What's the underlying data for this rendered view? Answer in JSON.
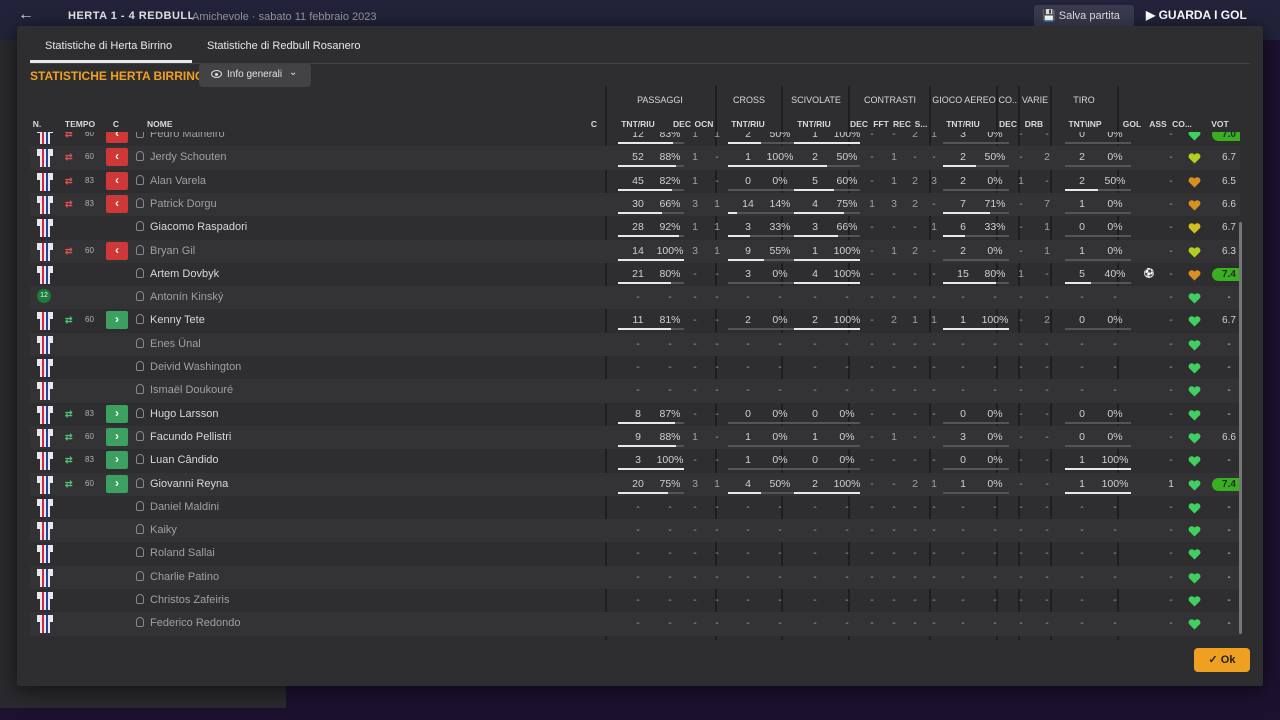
{
  "background": {
    "score": "HERTA  1 - 4  REDBULL",
    "venue": "Amichevole  ·  sabato 11 febbraio 2023",
    "save_label": "Salva partita",
    "watch_label": "GUARDA I GOL"
  },
  "tabs": [
    "Statistiche di Herta Birrino",
    "Statistiche di Redbull Rosanero"
  ],
  "title": "STATISTICHE HERTA BIRRINO",
  "view_select": "Info generali",
  "group_headers": [
    "PASSAGGI",
    "CROSS",
    "SCIVOLATE",
    "CONTRASTI",
    "GIOCO AEREO",
    "CO...",
    "VARIE",
    "TIRO"
  ],
  "sub_headers": {
    "n": "N.",
    "tempo": "TEMPO",
    "c": "C",
    "nome": "NOME",
    "c2": "C",
    "pass": "TNT/RIU",
    "dec": "DEC",
    "ocn": "OCN",
    "cross": "TNT/RIU",
    "scivolate": "TNT/RIU",
    "c_dec": "DEC",
    "c_fft": "FFT",
    "c_rec": "REC",
    "c_s": "S...",
    "aereo": "TNT/RIU",
    "co_dec": "DEC",
    "drb": "DRB",
    "tiro": "TNT\\INP",
    "gol": "GOL",
    "ass": "ASS",
    "co": "CO...",
    "vot": "VOT"
  },
  "colors": {
    "accent": "#f0a020",
    "sub_out": "#d03838",
    "sub_in": "#3ca060",
    "rating_good": "#38b020"
  },
  "rows": [
    {
      "kit": "shirt",
      "sub": "out",
      "min": "60",
      "name": "Pedro Malheiro",
      "starter": false,
      "pass": [
        "12",
        "83%"
      ],
      "dec": "1",
      "ocn": "1",
      "cross": [
        "2",
        "50%"
      ],
      "sciv": [
        "1",
        "100%"
      ],
      "c": [
        "-",
        "-",
        "2",
        "1"
      ],
      "aer": [
        "3",
        "0%"
      ],
      "codec": "-",
      "drb": "-",
      "tiro": [
        "0",
        "0%"
      ],
      "gol": "",
      "ass": "-",
      "heart": "green",
      "vot": "7.0",
      "votgreen": true
    },
    {
      "kit": "shirt",
      "sub": "out",
      "min": "60",
      "name": "Jerdy Schouten",
      "starter": false,
      "pass": [
        "52",
        "88%"
      ],
      "dec": "1",
      "ocn": "-",
      "cross": [
        "1",
        "100%"
      ],
      "sciv": [
        "2",
        "50%"
      ],
      "c": [
        "-",
        "1",
        "-",
        "-"
      ],
      "aer": [
        "2",
        "50%"
      ],
      "codec": "-",
      "drb": "2",
      "tiro": [
        "2",
        "0%"
      ],
      "gol": "",
      "ass": "-",
      "heart": "yellowgreen",
      "vot": "6.7",
      "votgreen": false
    },
    {
      "kit": "shirt",
      "sub": "out",
      "min": "83",
      "name": "Alan Varela",
      "starter": false,
      "pass": [
        "45",
        "82%"
      ],
      "dec": "1",
      "ocn": "-",
      "cross": [
        "0",
        "0%"
      ],
      "sciv": [
        "5",
        "60%"
      ],
      "c": [
        "-",
        "1",
        "2",
        "3"
      ],
      "aer": [
        "2",
        "0%"
      ],
      "codec": "1",
      "drb": "-",
      "tiro": [
        "2",
        "50%"
      ],
      "gol": "",
      "ass": "-",
      "heart": "orange",
      "vot": "6.5",
      "votgreen": false
    },
    {
      "kit": "shirt",
      "sub": "out",
      "min": "83",
      "name": "Patrick Dorgu",
      "starter": false,
      "pass": [
        "30",
        "66%"
      ],
      "dec": "3",
      "ocn": "1",
      "cross": [
        "14",
        "14%"
      ],
      "sciv": [
        "4",
        "75%"
      ],
      "c": [
        "1",
        "3",
        "2",
        "-"
      ],
      "aer": [
        "7",
        "71%"
      ],
      "codec": "-",
      "drb": "7",
      "tiro": [
        "1",
        "0%"
      ],
      "gol": "",
      "ass": "-",
      "heart": "orange",
      "vot": "6.6",
      "votgreen": false
    },
    {
      "kit": "shirt",
      "sub": "",
      "min": "",
      "name": "Giacomo Raspadori",
      "starter": true,
      "pass": [
        "28",
        "92%"
      ],
      "dec": "1",
      "ocn": "1",
      "cross": [
        "3",
        "33%"
      ],
      "sciv": [
        "3",
        "66%"
      ],
      "c": [
        "-",
        "-",
        "-",
        "1"
      ],
      "aer": [
        "6",
        "33%"
      ],
      "codec": "-",
      "drb": "1",
      "tiro": [
        "0",
        "0%"
      ],
      "gol": "",
      "ass": "-",
      "heart": "yellow",
      "vot": "6.7",
      "votgreen": false
    },
    {
      "kit": "shirt",
      "sub": "out",
      "min": "60",
      "name": "Bryan Gil",
      "starter": false,
      "pass": [
        "14",
        "100%"
      ],
      "dec": "3",
      "ocn": "1",
      "cross": [
        "9",
        "55%"
      ],
      "sciv": [
        "1",
        "100%"
      ],
      "c": [
        "-",
        "1",
        "2",
        "-"
      ],
      "aer": [
        "2",
        "0%"
      ],
      "codec": "-",
      "drb": "1",
      "tiro": [
        "1",
        "0%"
      ],
      "gol": "",
      "ass": "-",
      "heart": "yellowgreen",
      "vot": "6.3",
      "votgreen": false
    },
    {
      "kit": "shirt",
      "sub": "",
      "min": "",
      "name": "Artem Dovbyk",
      "starter": true,
      "pass": [
        "21",
        "80%"
      ],
      "dec": "-",
      "ocn": "-",
      "cross": [
        "3",
        "0%"
      ],
      "sciv": [
        "4",
        "100%"
      ],
      "c": [
        "-",
        "-",
        "-",
        "-"
      ],
      "aer": [
        "15",
        "80%"
      ],
      "codec": "1",
      "drb": "-",
      "tiro": [
        "5",
        "40%"
      ],
      "gol": "ball",
      "ass": "-",
      "heart": "orange",
      "vot": "7.4",
      "votgreen": true
    },
    {
      "kit": "gk",
      "gknum": "12",
      "sub": "",
      "min": "",
      "name": "Antonín Kinský",
      "starter": false,
      "pass": [
        "-",
        "-"
      ],
      "dec": "-",
      "ocn": "-",
      "cross": [
        "-",
        "-"
      ],
      "sciv": [
        "-",
        "-"
      ],
      "c": [
        "-",
        "-",
        "-",
        "-"
      ],
      "aer": [
        "-",
        "-"
      ],
      "codec": "-",
      "drb": "-",
      "tiro": [
        "-",
        "-"
      ],
      "gol": "",
      "ass": "-",
      "heart": "green",
      "vot": "-",
      "votgreen": false
    },
    {
      "kit": "shirt",
      "sub": "in",
      "min": "60",
      "name": "Kenny Tete",
      "starter": true,
      "pass": [
        "11",
        "81%"
      ],
      "dec": "-",
      "ocn": "-",
      "cross": [
        "2",
        "0%"
      ],
      "sciv": [
        "2",
        "100%"
      ],
      "c": [
        "-",
        "2",
        "1",
        "1"
      ],
      "aer": [
        "1",
        "100%"
      ],
      "codec": "-",
      "drb": "2",
      "tiro": [
        "0",
        "0%"
      ],
      "gol": "",
      "ass": "-",
      "heart": "green",
      "vot": "6.7",
      "votgreen": false
    },
    {
      "kit": "shirt",
      "sub": "",
      "min": "",
      "name": "Enes Ünal",
      "starter": false,
      "pass": [
        "-",
        "-"
      ],
      "dec": "-",
      "ocn": "-",
      "cross": [
        "-",
        "-"
      ],
      "sciv": [
        "-",
        "-"
      ],
      "c": [
        "-",
        "-",
        "-",
        "-"
      ],
      "aer": [
        "-",
        "-"
      ],
      "codec": "-",
      "drb": "-",
      "tiro": [
        "-",
        "-"
      ],
      "gol": "",
      "ass": "-",
      "heart": "green",
      "vot": "-",
      "votgreen": false
    },
    {
      "kit": "shirt",
      "sub": "",
      "min": "",
      "name": "Deivid Washington",
      "starter": false,
      "pass": [
        "-",
        "-"
      ],
      "dec": "-",
      "ocn": "-",
      "cross": [
        "-",
        "-"
      ],
      "sciv": [
        "-",
        "-"
      ],
      "c": [
        "-",
        "-",
        "-",
        "-"
      ],
      "aer": [
        "-",
        "-"
      ],
      "codec": "-",
      "drb": "-",
      "tiro": [
        "-",
        "-"
      ],
      "gol": "",
      "ass": "-",
      "heart": "green",
      "vot": "-",
      "votgreen": false
    },
    {
      "kit": "shirt",
      "sub": "",
      "min": "",
      "name": "Ismaël Doukouré",
      "starter": false,
      "pass": [
        "-",
        "-"
      ],
      "dec": "-",
      "ocn": "-",
      "cross": [
        "-",
        "-"
      ],
      "sciv": [
        "-",
        "-"
      ],
      "c": [
        "-",
        "-",
        "-",
        "-"
      ],
      "aer": [
        "-",
        "-"
      ],
      "codec": "-",
      "drb": "-",
      "tiro": [
        "-",
        "-"
      ],
      "gol": "",
      "ass": "-",
      "heart": "green",
      "vot": "-",
      "votgreen": false
    },
    {
      "kit": "shirt",
      "sub": "in",
      "min": "83",
      "name": "Hugo Larsson",
      "starter": true,
      "pass": [
        "8",
        "87%"
      ],
      "dec": "-",
      "ocn": "-",
      "cross": [
        "0",
        "0%"
      ],
      "sciv": [
        "0",
        "0%"
      ],
      "c": [
        "-",
        "-",
        "-",
        "-"
      ],
      "aer": [
        "0",
        "0%"
      ],
      "codec": "-",
      "drb": "-",
      "tiro": [
        "0",
        "0%"
      ],
      "gol": "",
      "ass": "-",
      "heart": "green",
      "vot": "-",
      "votgreen": false
    },
    {
      "kit": "shirt",
      "sub": "in",
      "min": "60",
      "name": "Facundo Pellistri",
      "starter": true,
      "pass": [
        "9",
        "88%"
      ],
      "dec": "1",
      "ocn": "-",
      "cross": [
        "1",
        "0%"
      ],
      "sciv": [
        "1",
        "0%"
      ],
      "c": [
        "-",
        "1",
        "-",
        "-"
      ],
      "aer": [
        "3",
        "0%"
      ],
      "codec": "-",
      "drb": "-",
      "tiro": [
        "0",
        "0%"
      ],
      "gol": "",
      "ass": "-",
      "heart": "green",
      "vot": "6.6",
      "votgreen": false
    },
    {
      "kit": "shirt",
      "sub": "in",
      "min": "83",
      "name": "Luan Cândido",
      "starter": true,
      "pass": [
        "3",
        "100%"
      ],
      "dec": "-",
      "ocn": "-",
      "cross": [
        "1",
        "0%"
      ],
      "sciv": [
        "0",
        "0%"
      ],
      "c": [
        "-",
        "-",
        "-",
        "-"
      ],
      "aer": [
        "0",
        "0%"
      ],
      "codec": "-",
      "drb": "-",
      "tiro": [
        "1",
        "100%"
      ],
      "gol": "",
      "ass": "-",
      "heart": "green",
      "vot": "-",
      "votgreen": false
    },
    {
      "kit": "shirt",
      "sub": "in",
      "min": "60",
      "name": "Giovanni Reyna",
      "starter": true,
      "pass": [
        "20",
        "75%"
      ],
      "dec": "3",
      "ocn": "1",
      "cross": [
        "4",
        "50%"
      ],
      "sciv": [
        "2",
        "100%"
      ],
      "c": [
        "-",
        "-",
        "2",
        "1"
      ],
      "aer": [
        "1",
        "0%"
      ],
      "codec": "-",
      "drb": "-",
      "tiro": [
        "1",
        "100%"
      ],
      "gol": "",
      "ass": "1",
      "heart": "green",
      "vot": "7.4",
      "votgreen": true
    },
    {
      "kit": "shirt",
      "sub": "",
      "min": "",
      "name": "Daniel Maldini",
      "starter": false,
      "pass": [
        "-",
        "-"
      ],
      "dec": "-",
      "ocn": "-",
      "cross": [
        "-",
        "-"
      ],
      "sciv": [
        "-",
        "-"
      ],
      "c": [
        "-",
        "-",
        "-",
        "-"
      ],
      "aer": [
        "-",
        "-"
      ],
      "codec": "-",
      "drb": "-",
      "tiro": [
        "-",
        "-"
      ],
      "gol": "",
      "ass": "-",
      "heart": "green",
      "vot": "-",
      "votgreen": false
    },
    {
      "kit": "shirt",
      "sub": "",
      "min": "",
      "name": "Kaiky",
      "starter": false,
      "pass": [
        "-",
        "-"
      ],
      "dec": "-",
      "ocn": "-",
      "cross": [
        "-",
        "-"
      ],
      "sciv": [
        "-",
        "-"
      ],
      "c": [
        "-",
        "-",
        "-",
        "-"
      ],
      "aer": [
        "-",
        "-"
      ],
      "codec": "-",
      "drb": "-",
      "tiro": [
        "-",
        "-"
      ],
      "gol": "",
      "ass": "-",
      "heart": "green",
      "vot": "-",
      "votgreen": false
    },
    {
      "kit": "shirt",
      "sub": "",
      "min": "",
      "name": "Roland Sallai",
      "starter": false,
      "pass": [
        "-",
        "-"
      ],
      "dec": "-",
      "ocn": "-",
      "cross": [
        "-",
        "-"
      ],
      "sciv": [
        "-",
        "-"
      ],
      "c": [
        "-",
        "-",
        "-",
        "-"
      ],
      "aer": [
        "-",
        "-"
      ],
      "codec": "-",
      "drb": "-",
      "tiro": [
        "-",
        "-"
      ],
      "gol": "",
      "ass": "-",
      "heart": "green",
      "vot": "-",
      "votgreen": false
    },
    {
      "kit": "shirt",
      "sub": "",
      "min": "",
      "name": "Charlie Patino",
      "starter": false,
      "pass": [
        "-",
        "-"
      ],
      "dec": "-",
      "ocn": "-",
      "cross": [
        "-",
        "-"
      ],
      "sciv": [
        "-",
        "-"
      ],
      "c": [
        "-",
        "-",
        "-",
        "-"
      ],
      "aer": [
        "-",
        "-"
      ],
      "codec": "-",
      "drb": "-",
      "tiro": [
        "-",
        "-"
      ],
      "gol": "",
      "ass": "-",
      "heart": "green",
      "vot": "-",
      "votgreen": false
    },
    {
      "kit": "shirt",
      "sub": "",
      "min": "",
      "name": "Christos Zafeiris",
      "starter": false,
      "pass": [
        "-",
        "-"
      ],
      "dec": "-",
      "ocn": "-",
      "cross": [
        "-",
        "-"
      ],
      "sciv": [
        "-",
        "-"
      ],
      "c": [
        "-",
        "-",
        "-",
        "-"
      ],
      "aer": [
        "-",
        "-"
      ],
      "codec": "-",
      "drb": "-",
      "tiro": [
        "-",
        "-"
      ],
      "gol": "",
      "ass": "-",
      "heart": "green",
      "vot": "-",
      "votgreen": false
    },
    {
      "kit": "shirt",
      "sub": "",
      "min": "",
      "name": "Federico Redondo",
      "starter": false,
      "pass": [
        "-",
        "-"
      ],
      "dec": "-",
      "ocn": "-",
      "cross": [
        "-",
        "-"
      ],
      "sciv": [
        "-",
        "-"
      ],
      "c": [
        "-",
        "-",
        "-",
        "-"
      ],
      "aer": [
        "-",
        "-"
      ],
      "codec": "-",
      "drb": "-",
      "tiro": [
        "-",
        "-"
      ],
      "gol": "",
      "ass": "-",
      "heart": "green",
      "vot": "-",
      "votgreen": false
    }
  ],
  "ok_label": "Ok"
}
